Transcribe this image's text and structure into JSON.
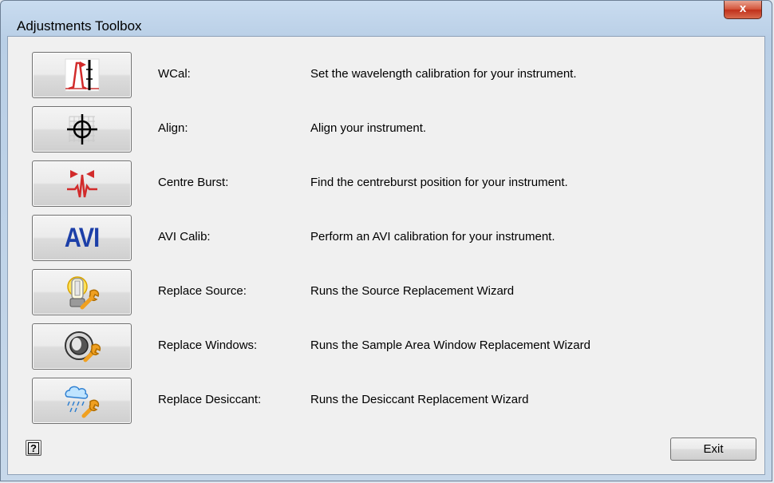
{
  "window": {
    "title": "Adjustments Toolbox",
    "close_label": "x"
  },
  "tools": [
    {
      "icon": "wavelength-calibration-icon",
      "label": "WCal:",
      "description": "Set the wavelength calibration for your instrument."
    },
    {
      "icon": "crosshair-align-icon",
      "label": "Align:",
      "description": "Align your instrument."
    },
    {
      "icon": "centreburst-icon",
      "label": "Centre Burst:",
      "description": "Find the centreburst position for your instrument."
    },
    {
      "icon": "avi-icon",
      "label": "AVI Calib:",
      "description": "Perform an AVI calibration for your instrument.",
      "icon_text": "AVI"
    },
    {
      "icon": "lamp-wrench-icon",
      "label": "Replace Source:",
      "description": "Runs the Source Replacement Wizard"
    },
    {
      "icon": "window-wrench-icon",
      "label": "Replace Windows:",
      "description": "Runs the Sample Area Window Replacement Wizard"
    },
    {
      "icon": "desiccant-wrench-icon",
      "label": "Replace Desiccant:",
      "description": "Runs the Desiccant Replacement Wizard"
    }
  ],
  "footer": {
    "help_label": "?",
    "exit_label": "Exit"
  },
  "colors": {
    "accent_red": "#d22b2b",
    "avi_blue": "#1c3fa8",
    "wrench_orange": "#f0a020"
  }
}
